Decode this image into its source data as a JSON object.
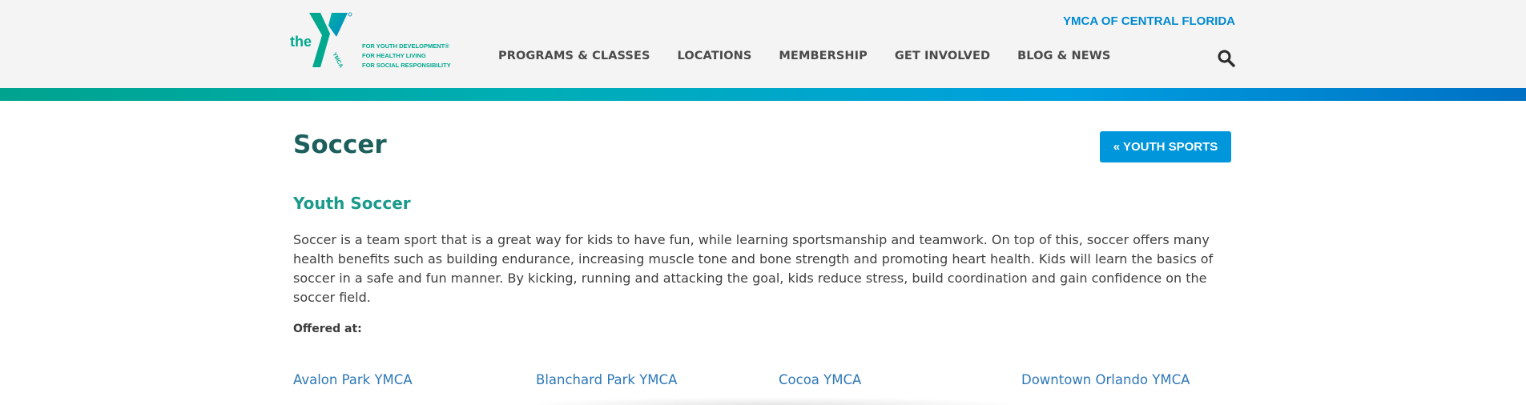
{
  "header": {
    "logo": {
      "word": "the",
      "y_label": "YMCA",
      "taglines": [
        "FOR YOUTH DEVELOPMENT®",
        "FOR HEALTHY LIVING",
        "FOR SOCIAL RESPONSIBILITY"
      ]
    },
    "nav": [
      {
        "label": "PROGRAMS & CLASSES"
      },
      {
        "label": "LOCATIONS"
      },
      {
        "label": "MEMBERSHIP"
      },
      {
        "label": "GET INVOLVED"
      },
      {
        "label": "BLOG & NEWS"
      }
    ],
    "org_link": "YMCA OF CENTRAL FLORIDA",
    "search_icon": "search-icon"
  },
  "colors": {
    "brand_teal": "#00a88f",
    "brand_blue": "#0096db",
    "title": "#1c5f5d",
    "link": "#2f78b8"
  },
  "main": {
    "title": "Soccer",
    "back_button": "« YOUTH SPORTS",
    "section_title": "Youth Soccer",
    "description": "Soccer is a team sport that is a great way for kids to have fun, while learning sportsmanship and teamwork. On top of this, soccer offers many health benefits such as building endurance, increasing muscle tone and bone strength and promoting heart health. Kids will learn the basics of soccer in a safe and fun manner. By kicking, running and attacking the goal, kids reduce stress, build coordination and gain confidence on the soccer field.",
    "offered_label": "Offered at:",
    "locations": [
      {
        "label": "Avalon Park YMCA"
      },
      {
        "label": "Blanchard Park YMCA"
      },
      {
        "label": "Cocoa YMCA"
      },
      {
        "label": "Downtown Orlando YMCA"
      }
    ]
  }
}
